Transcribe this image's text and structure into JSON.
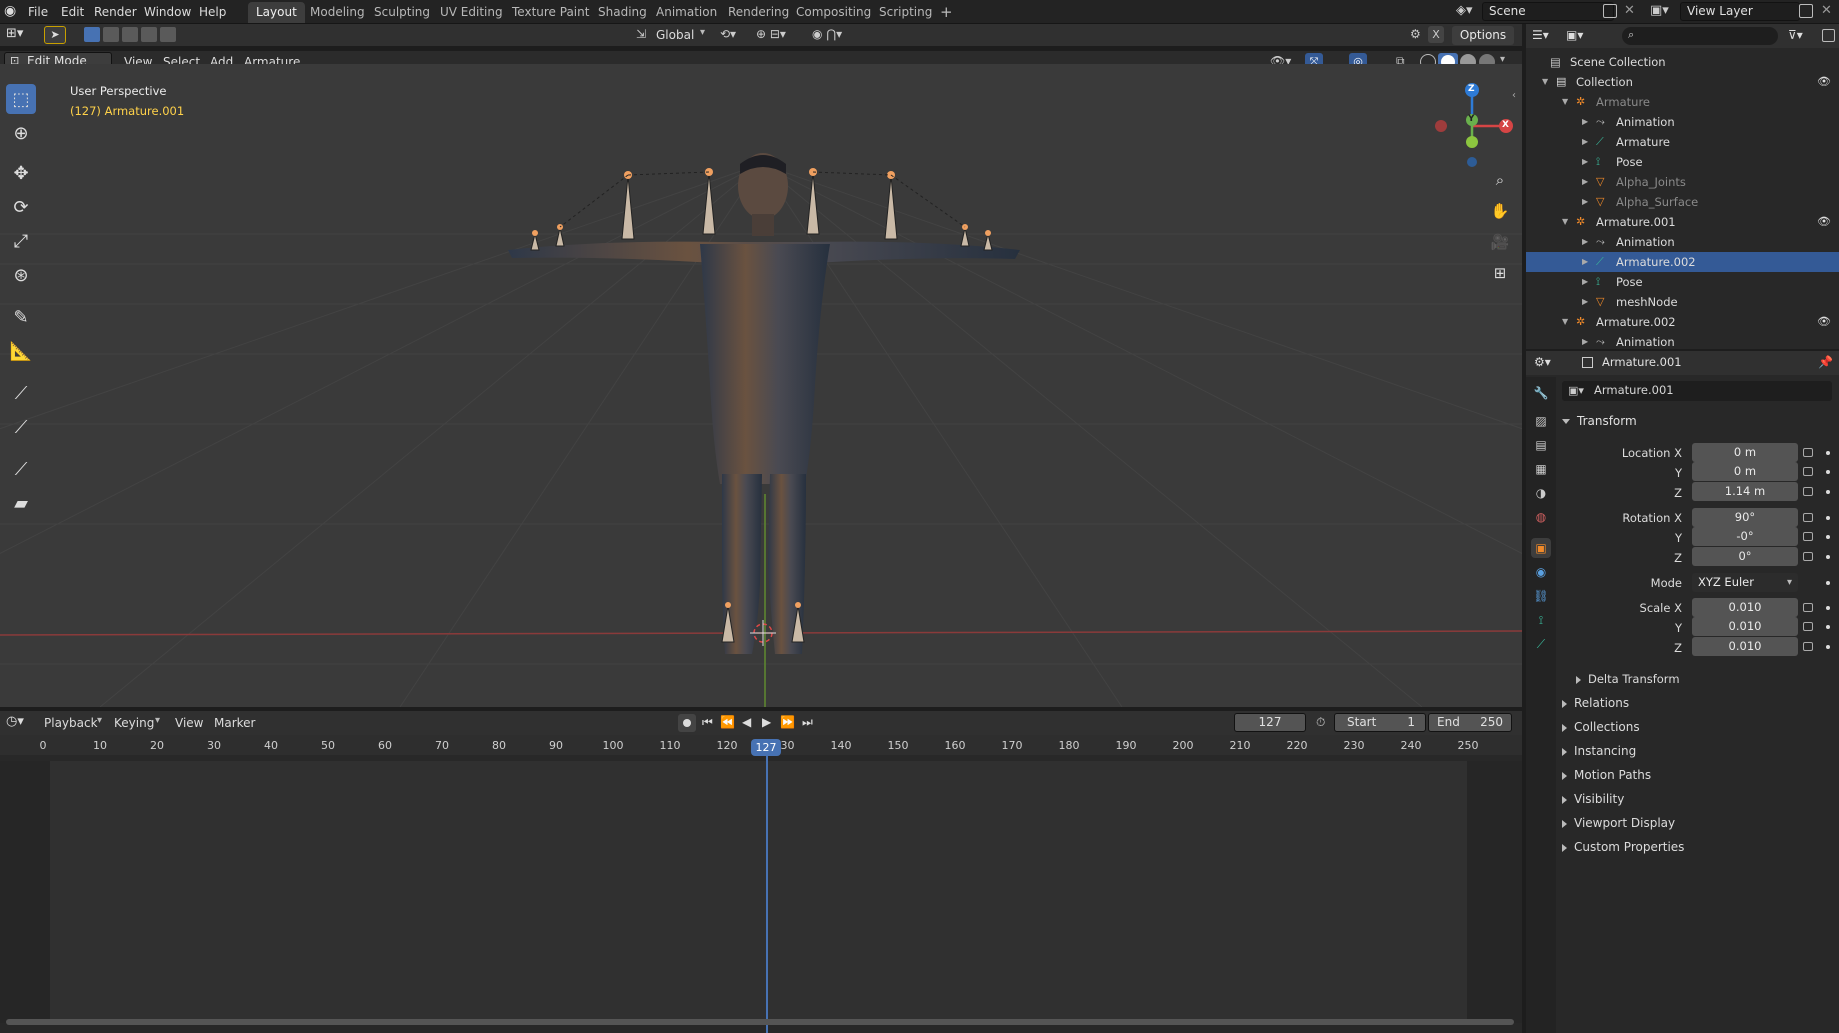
{
  "menu": {
    "items": [
      "File",
      "Edit",
      "Render",
      "Window",
      "Help"
    ]
  },
  "workspaces": [
    "Layout",
    "Modeling",
    "Sculpting",
    "UV Editing",
    "Texture Paint",
    "Shading",
    "Animation",
    "Rendering",
    "Compositing",
    "Scripting"
  ],
  "active_workspace": "Layout",
  "scene": {
    "name": "Scene",
    "view_layer": "View Layer"
  },
  "tool_header": {
    "orientation": "Global",
    "options_label": "Options"
  },
  "viewport_header": {
    "mode": "Edit Mode",
    "menus": [
      "View",
      "Select",
      "Add",
      "Armature"
    ]
  },
  "viewport": {
    "perspective_label": "User Perspective",
    "object_label": "(127) Armature.001",
    "gizmo": {
      "x": "X",
      "y": "Y",
      "z": "Z"
    }
  },
  "timeline": {
    "menus": [
      "Playback",
      "Keying",
      "View",
      "Marker"
    ],
    "current_frame": "127",
    "start_label": "Start",
    "start_value": "1",
    "end_label": "End",
    "end_value": "250",
    "ticks": [
      "0",
      "10",
      "20",
      "30",
      "40",
      "50",
      "60",
      "70",
      "80",
      "90",
      "100",
      "110",
      "120",
      "130",
      "140",
      "150",
      "160",
      "170",
      "180",
      "190",
      "200",
      "210",
      "220",
      "230",
      "240",
      "250"
    ],
    "playhead_label": "127"
  },
  "outliner": {
    "root": "Scene Collection",
    "rows": [
      {
        "label": "Collection",
        "indent": 0
      },
      {
        "label": "Armature",
        "indent": 1,
        "dim": true
      },
      {
        "label": "Animation",
        "indent": 2
      },
      {
        "label": "Armature",
        "indent": 2
      },
      {
        "label": "Pose",
        "indent": 2
      },
      {
        "label": "Alpha_Joints",
        "indent": 2,
        "dim": true
      },
      {
        "label": "Alpha_Surface",
        "indent": 2,
        "dim": true
      },
      {
        "label": "Armature.001",
        "indent": 1
      },
      {
        "label": "Animation",
        "indent": 2
      },
      {
        "label": "Armature.002",
        "indent": 2,
        "selected": true
      },
      {
        "label": "Pose",
        "indent": 2
      },
      {
        "label": "meshNode",
        "indent": 2
      },
      {
        "label": "Armature.002",
        "indent": 1
      },
      {
        "label": "Animation",
        "indent": 2
      }
    ]
  },
  "properties": {
    "header_object": "Armature.001",
    "object_name": "Armature.001",
    "transform_title": "Transform",
    "location_label": "Location X",
    "rotation_label": "Rotation X",
    "scale_label": "Scale X",
    "y_label": "Y",
    "z_label": "Z",
    "location": [
      "0 m",
      "0 m",
      "1.14 m"
    ],
    "rotation": [
      "90°",
      "-0°",
      "0°"
    ],
    "mode_label": "Mode",
    "mode_value": "XYZ Euler",
    "scale": [
      "0.010",
      "0.010",
      "0.010"
    ],
    "delta_transform": "Delta Transform",
    "sections": [
      "Relations",
      "Collections",
      "Instancing",
      "Motion Paths",
      "Visibility",
      "Viewport Display",
      "Custom Properties"
    ]
  }
}
